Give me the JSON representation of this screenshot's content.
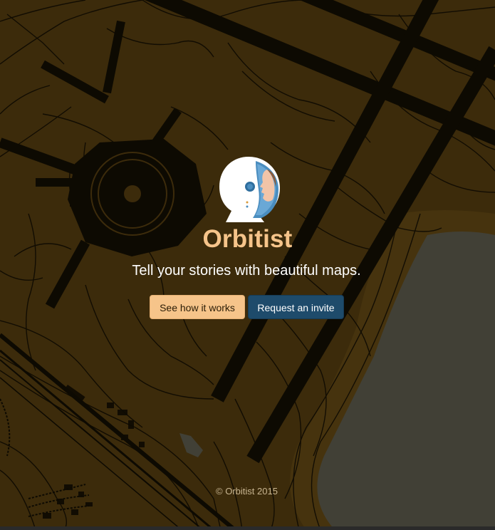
{
  "brand": {
    "name": "Orbitist",
    "tagline": "Tell your stories with beautiful maps.",
    "logo_icon": "astronaut-helmet-icon"
  },
  "actions": {
    "primary_label": "See how it works",
    "secondary_label": "Request an invite"
  },
  "footer": {
    "copyright": "© Orbitist 2015"
  },
  "colors": {
    "map_land": "#3f2e0c",
    "map_roads": "#0d0a03",
    "map_water": "#45453b",
    "accent": "#f6c48a",
    "secondary_button": "#1e4b6b"
  }
}
